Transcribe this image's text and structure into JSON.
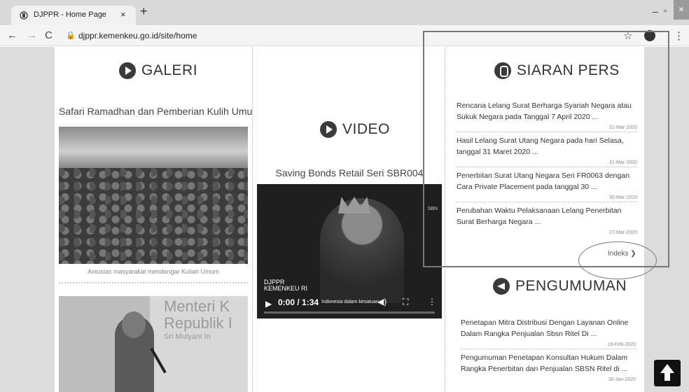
{
  "browser": {
    "tab_title": "DJPPR - Home Page",
    "tab_close": "×",
    "new_tab": "+",
    "url": "djppr.kemenkeu.go.id/site/home",
    "back": "←",
    "forward": "→",
    "reload": "C",
    "lock": "🔒",
    "star": "☆",
    "menu": "⋮",
    "minimize": "–",
    "maximize": "▫",
    "close": "×"
  },
  "galeri": {
    "title": "GALERI",
    "caption": "Safari Ramadhan dan Pemberian Kulih Umum",
    "photo_caption": "Antusias masyarakat mendengar Kuliah Umum",
    "banner_line1": "Menteri K",
    "banner_line2": "Republik I",
    "banner_line3": "Sri Mulyani In"
  },
  "video": {
    "title": "VIDEO",
    "caption": "Saving Bonds Retail Seri SBR004",
    "brand_line1": "DJPPR",
    "brand_line2": "KEMENKEU RI",
    "sbn_badge": "SBN",
    "play": "▶",
    "time": "0:00 / 1:34",
    "subtitle": "Indonesia dalam kesatuan...",
    "volume": "◀)",
    "fullscreen": "⛶",
    "menu": "⋮"
  },
  "siaran_pers": {
    "title": "SIARAN PERS",
    "items": [
      {
        "title": "Rencana Lelang Surat Berharga Syariah Negara atau Sukuk Negara pada Tanggal 7 April 2020 ...",
        "date": "31-Mar-2020"
      },
      {
        "title": "Hasil Lelang Surat Utang Negara pada hari Selasa, tanggal 31 Maret 2020 ...",
        "date": "31-Mar-2020"
      },
      {
        "title": "Penerbitan Surat Utang Negara Seri FR0063 dengan Cara Private Placement pada tanggal 30 ...",
        "date": "30-Mar-2020"
      },
      {
        "title": "Perubahan Waktu Pelaksanaan Lelang Penerbitan Surat Berharga Negara ...",
        "date": "27-Mar-2020"
      }
    ],
    "indeks": "Indeks ❯"
  },
  "pengumuman": {
    "title": "PENGUMUMAN",
    "items": [
      {
        "title": "Penetapan Mitra Distribusi Dengan Layanan Online Dalam Rangka Penjualan Sbsn Ritel Di ...",
        "date": "19-Feb-2020"
      },
      {
        "title": "Pengumuman Penetapan Konsultan Hukum Dalam Rangka Penerbitan dan Penjualan SBSN Ritel di ...",
        "date": "30-Jan-2020"
      }
    ]
  }
}
